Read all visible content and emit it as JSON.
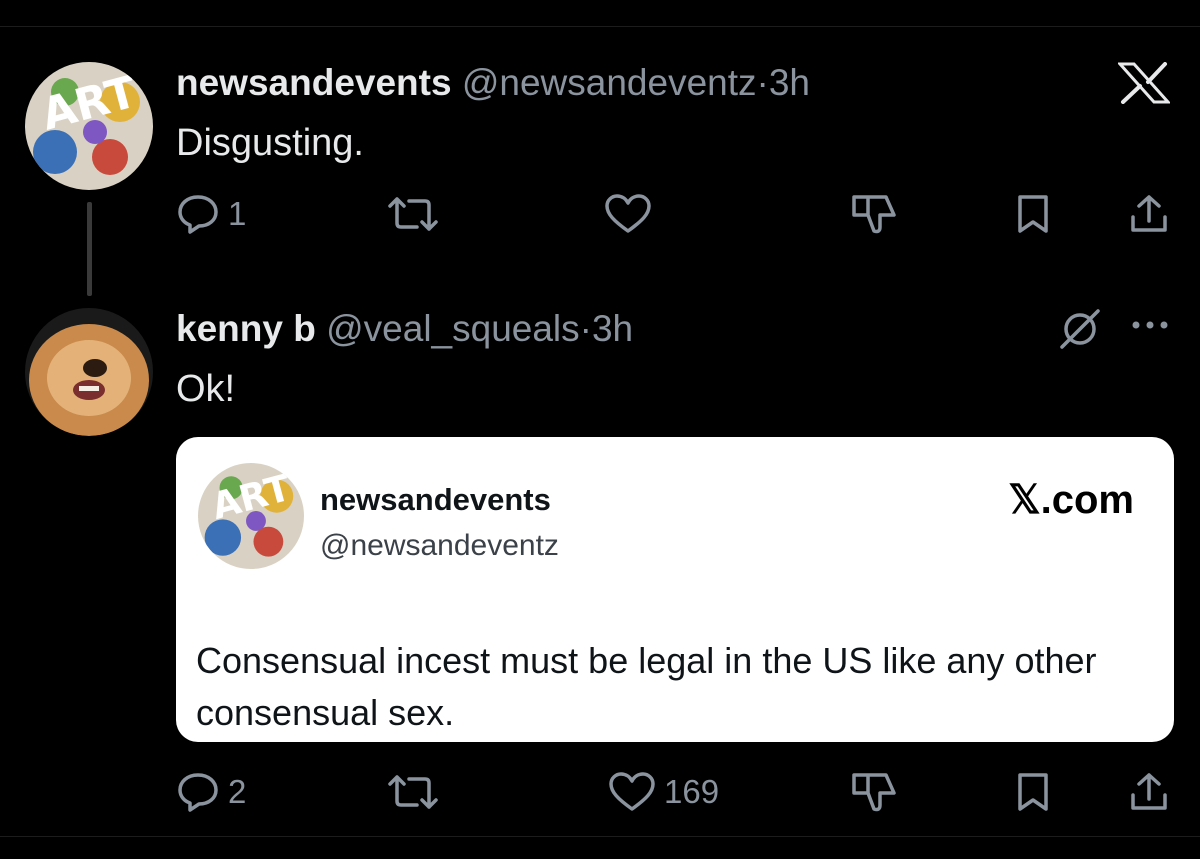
{
  "post1": {
    "author_name": "newsandevents",
    "author_handle": "@newsandeventz",
    "separator": "·",
    "time": "3h",
    "text": "Disgusting.",
    "reply_count": "1",
    "like_count": ""
  },
  "post2": {
    "author_name": "kenny b",
    "author_handle": "@veal_squeals",
    "separator": "·",
    "time": "3h",
    "text": "Ok!",
    "reply_count": "2",
    "like_count": "169"
  },
  "quote_card": {
    "author_name": "newsandevents",
    "author_handle": "@newsandeventz",
    "site": "𝕏.com",
    "text": "Consensual incest must be legal in the US like any other consensual sex."
  },
  "icons": {
    "top_right": "x-logo-icon",
    "post2_right": [
      "muted-grok-icon",
      "more-icon"
    ],
    "actions": [
      "reply-icon",
      "repost-icon",
      "like-icon",
      "downvote-icon",
      "bookmark-icon",
      "share-icon"
    ]
  },
  "colors": {
    "background": "#000000",
    "text": "#e7e9ea",
    "muted": "#8b949e",
    "card_bg": "#ffffff"
  }
}
